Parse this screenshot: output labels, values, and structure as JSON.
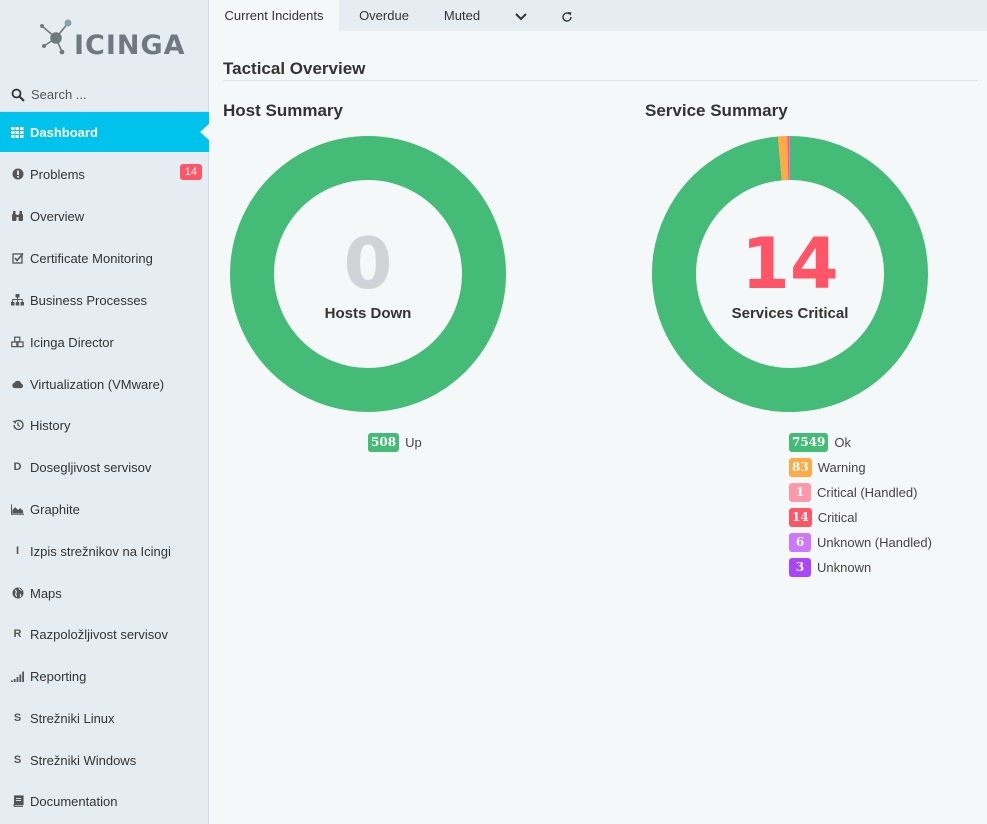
{
  "app": {
    "logo_text": "ICINGA"
  },
  "search": {
    "placeholder": "Search ..."
  },
  "sidebar": {
    "items": [
      {
        "label": "Dashboard",
        "icon": "grid-icon"
      },
      {
        "label": "Problems",
        "icon": "alert-circle-icon",
        "badge": "14"
      },
      {
        "label": "Overview",
        "icon": "binoculars-icon"
      },
      {
        "label": "Certificate Monitoring",
        "icon": "check-square-icon"
      },
      {
        "label": "Business Processes",
        "icon": "sitemap-icon"
      },
      {
        "label": "Icinga Director",
        "icon": "cubes-icon"
      },
      {
        "label": "Virtualization (VMware)",
        "icon": "cloud-icon"
      },
      {
        "label": "History",
        "icon": "history-icon"
      },
      {
        "label": "Dosegljivost servisov",
        "icon": "letter-d-icon",
        "glyph": "D"
      },
      {
        "label": "Graphite",
        "icon": "area-chart-icon"
      },
      {
        "label": "Izpis strežnikov na Icingi",
        "icon": "letter-i-icon",
        "glyph": "I"
      },
      {
        "label": "Maps",
        "icon": "globe-icon"
      },
      {
        "label": "Razpoložljivost servisov",
        "icon": "letter-r-icon",
        "glyph": "R"
      },
      {
        "label": "Reporting",
        "icon": "signal-bars-icon"
      },
      {
        "label": "Strežniki Linux",
        "icon": "letter-s-icon",
        "glyph": "S"
      },
      {
        "label": "Strežniki Windows",
        "icon": "letter-s-icon",
        "glyph": "S"
      },
      {
        "label": "Documentation",
        "icon": "book-icon"
      }
    ]
  },
  "tabs": [
    {
      "label": "Current Incidents",
      "active": true
    },
    {
      "label": "Overdue"
    },
    {
      "label": "Muted"
    }
  ],
  "page": {
    "title": "Tactical Overview"
  },
  "host_summary": {
    "title": "Host Summary",
    "center_value": "0",
    "center_label": "Hosts Down",
    "legend": [
      {
        "value": "508",
        "label": "Up",
        "color": "#44bb77"
      }
    ]
  },
  "service_summary": {
    "title": "Service Summary",
    "center_value": "14",
    "center_label": "Services Critical",
    "legend": [
      {
        "value": "7549",
        "label": "Ok",
        "color": "#44bb77"
      },
      {
        "value": "83",
        "label": "Warning",
        "color": "#ffaa44"
      },
      {
        "value": "1",
        "label": "Critical (Handled)",
        "color": "#ff99aa"
      },
      {
        "value": "14",
        "label": "Critical",
        "color": "#ff5566"
      },
      {
        "value": "6",
        "label": "Unknown (Handled)",
        "color": "#cc77ff"
      },
      {
        "value": "3",
        "label": "Unknown",
        "color": "#aa44ff"
      }
    ]
  },
  "chart_data": [
    {
      "type": "pie",
      "title": "Host Summary",
      "categories": [
        "Up"
      ],
      "values": [
        508
      ],
      "colors": [
        "#44bb77"
      ]
    },
    {
      "type": "pie",
      "title": "Service Summary",
      "categories": [
        "Ok",
        "Warning",
        "Critical (Handled)",
        "Critical",
        "Unknown (Handled)",
        "Unknown"
      ],
      "values": [
        7549,
        83,
        1,
        14,
        6,
        3
      ],
      "colors": [
        "#44bb77",
        "#ffaa44",
        "#ff99aa",
        "#ff5566",
        "#cc77ff",
        "#aa44ff"
      ]
    }
  ],
  "colors": {
    "accent": "#00c3ed",
    "host_center": "#d0d4d8",
    "critical": "#ff5566"
  }
}
